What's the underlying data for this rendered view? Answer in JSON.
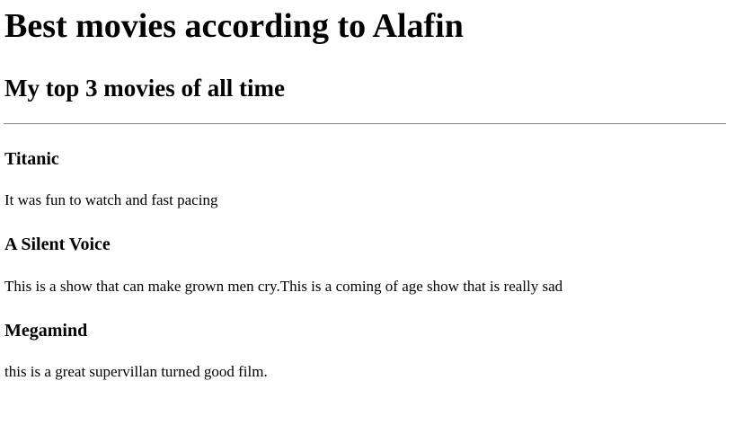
{
  "page": {
    "title": "Best movies according to Alafin",
    "subtitle": "My top 3 movies of all time"
  },
  "movies": [
    {
      "title": "Titanic",
      "description": "It was fun to watch and fast pacing"
    },
    {
      "title": "A Silent Voice",
      "description": "This is a show that can make grown men cry.This is a coming of age show that is really sad"
    },
    {
      "title": "Megamind",
      "description": "this is a great supervillan turned good film."
    }
  ]
}
